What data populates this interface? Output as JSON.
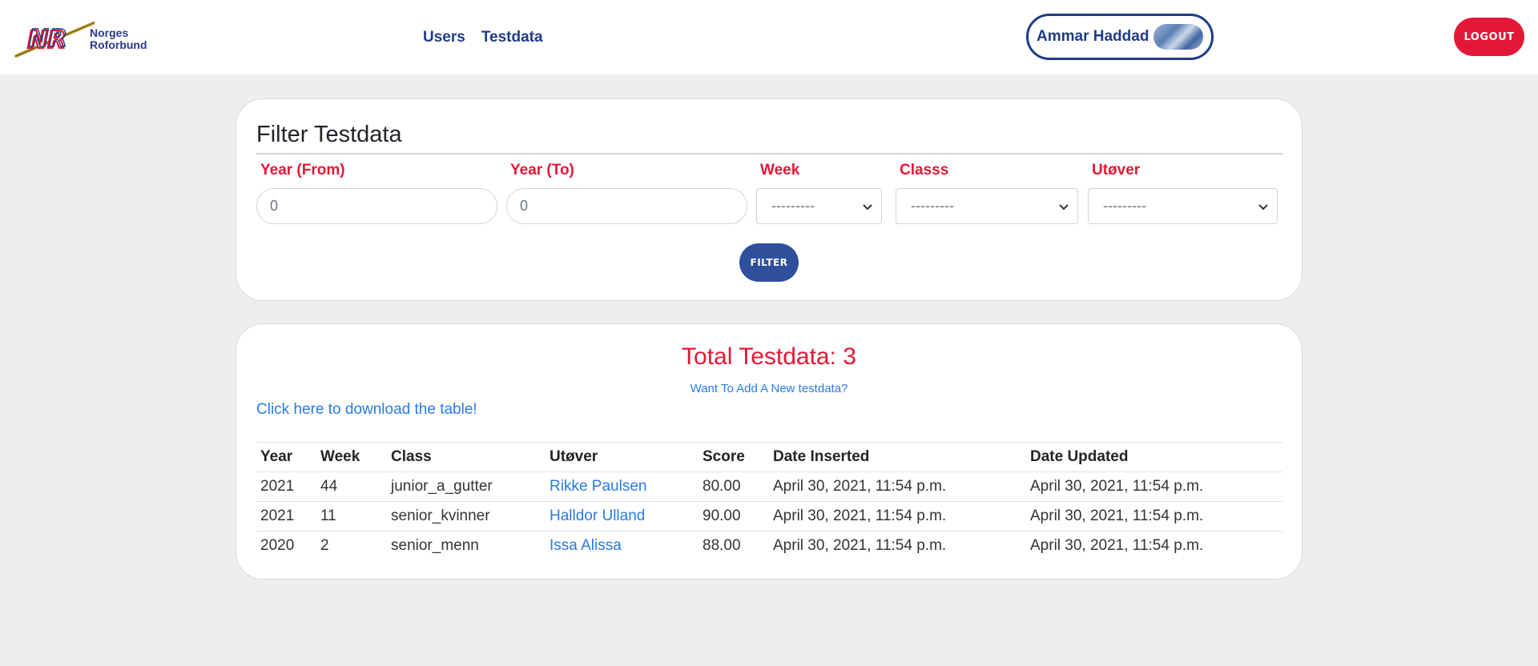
{
  "brand": {
    "line1": "Norges",
    "line2": "Roforbund",
    "logo_letters": "NR"
  },
  "nav": {
    "users": "Users",
    "testdata": "Testdata"
  },
  "user": {
    "name": "Ammar Haddad"
  },
  "header": {
    "logout": "LOGOUT"
  },
  "colors": {
    "primary": "#1f3c88",
    "accent": "#e31837",
    "link": "#2a7be4",
    "button": "#2f4f9a"
  },
  "filter": {
    "title": "Filter Testdata",
    "year_from": {
      "label": "Year (From)",
      "value": "0"
    },
    "year_to": {
      "label": "Year (To)",
      "value": "0"
    },
    "week": {
      "label": "Week",
      "selected": "---------"
    },
    "classs": {
      "label": "Classs",
      "selected": "---------"
    },
    "utover": {
      "label": "Utøver",
      "selected": "---------"
    },
    "button": "FILTER"
  },
  "results": {
    "total": "Total Testdata: 3",
    "add_link": "Want To Add A New testdata?",
    "download_link": "Click here to download the table!",
    "columns": [
      "Year",
      "Week",
      "Class",
      "Utøver",
      "Score",
      "Date Inserted",
      "Date Updated"
    ],
    "rows": [
      [
        "2021",
        "44",
        "junior_a_gutter",
        "Rikke Paulsen",
        "80.00",
        "April 30, 2021, 11:54 p.m.",
        "April 30, 2021, 11:54 p.m."
      ],
      [
        "2021",
        "11",
        "senior_kvinner",
        "Halldor Ulland",
        "90.00",
        "April 30, 2021, 11:54 p.m.",
        "April 30, 2021, 11:54 p.m."
      ],
      [
        "2020",
        "2",
        "senior_menn",
        "Issa Alissa",
        "88.00",
        "April 30, 2021, 11:54 p.m.",
        "April 30, 2021, 11:54 p.m."
      ]
    ]
  }
}
